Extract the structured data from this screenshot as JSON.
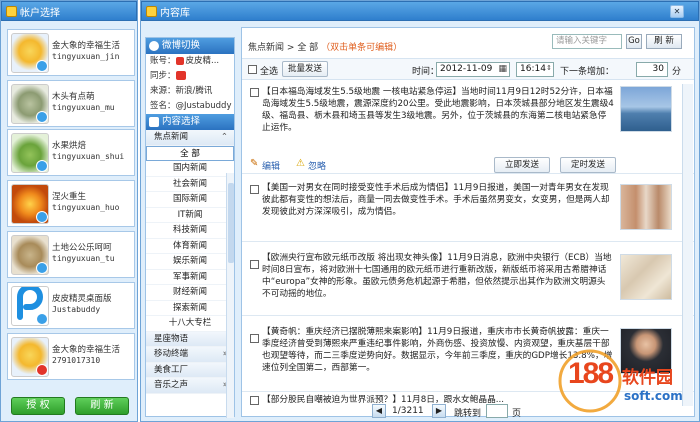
{
  "left": {
    "title": "帐户选择",
    "accounts": [
      {
        "name": "金大象的幸福生活",
        "id": "tingyuxuan_jin"
      },
      {
        "name": "木头有点萌",
        "id": "tingyuxuan_mu"
      },
      {
        "name": "水果烘焙",
        "id": "tingyuxuan_shui"
      },
      {
        "name": "涅火重生",
        "id": "tingyuxuan_huo"
      },
      {
        "name": "土地公公乐呵呵",
        "id": "tingyuxuan_tu"
      },
      {
        "name": "皮皮精灵桌面版",
        "id": "Justabuddy"
      },
      {
        "name": "金大象的幸福生活",
        "id": "2791017310"
      }
    ],
    "auth_label": "授 权",
    "refresh_label": "刷 新"
  },
  "main": {
    "title": "内容库",
    "nav": {
      "weibo_header": "微博切换",
      "account_label": "账号：",
      "account_value": "皮皮精...",
      "sync_label": "同步：",
      "source_label": "来源：新浪/腾讯",
      "signature_label": "签名：@Justabuddy",
      "content_header": "内容选择",
      "group1": "焦点新闻",
      "categories": [
        "全 部",
        "国内新闻",
        "社会新闻",
        "国际新闻",
        "IT新闻",
        "科技新闻",
        "体育新闻",
        "娱乐新闻",
        "军事新闻",
        "财经新闻",
        "探索新闻",
        "十八大专栏"
      ],
      "group2": "星座物语",
      "group3": "移动终端",
      "group4": "美食工厂",
      "group5": "音乐之声"
    },
    "content": {
      "breadcrumb_root": "焦点新闻",
      "breadcrumb_sep": ">",
      "breadcrumb_current": "全 部",
      "breadcrumb_hint": "（双击单条可编辑）",
      "search_placeholder": "请输入关键字",
      "go_label": "Go",
      "refresh_label": "刷 新",
      "select_all_label": "全选",
      "batch_send_label": "批量发送",
      "time_label": "时间：",
      "date_value": "2012-11-09",
      "time_value": "16:14",
      "next_add_label": "下一条增加：",
      "interval_value": "30",
      "interval_unit": "分",
      "items": [
        {
          "text": "【日本福岛海域发生5.5级地震 一核电站紧急停运】当地时间11月9日12时52分许，日本福岛海域发生5.5级地震，震源深度约20公里。受此地震影响，日本茨城县部分地区发生震级4级、福岛县、栃木县和埼玉县等发生3级地震。另外，位于茨城县的东海第二核电站紧急停止运作。"
        },
        {
          "text": "【美国一对男女在同时接受变性手术后成为情侣】11月9日报道，美国一对青年男女在发现彼此都有变性的想法后，商量一同去做变性手术。手术后虽然男变女，女变男，但是两人却发现彼此对方深深吸引，成为情侣。"
        },
        {
          "text": "【欧洲央行宣布欧元纸币改版 将出现女神头像】11月9日消息，欧洲中央银行（ECB）当地时间8日宣布，将对欧洲十七国通用的欧元纸币进行重新改版，新版纸币将采用古希腊神话中“europa”女神的形象。虽欧元债务危机起源于希腊，但依然提示出其作为欧洲文明源头不可动摇的地位。"
        },
        {
          "text": "【黄奇帆：重庆经济已摆脱薄熙来案影响】11月9日报道，重庆市市长黄奇帆披露：重庆一季度经济曾受到薄熙来严重违纪事件影响，外商伤感、投资放慢、内资观望，重庆基层干部也观望等待，而二三季度逆势向好。数据显示，今年前三季度，重庆的GDP增长13.8%，增速位列全国第二，西部第一。"
        },
        {
          "text": "【部分股民自嘲被迫为世界派预？】11月8日，跟水女鲍晶晶..."
        }
      ],
      "edit_label": "编辑",
      "ignore_label": "忽略",
      "send_now_label": "立即发送",
      "scheduled_send_label": "定时发送",
      "page_indicator": "1/3211",
      "jump_label": "跳转到",
      "page_unit": "页"
    }
  },
  "watermark": {
    "number": "188",
    "brand": "软件园",
    "domain": "soft.com"
  }
}
